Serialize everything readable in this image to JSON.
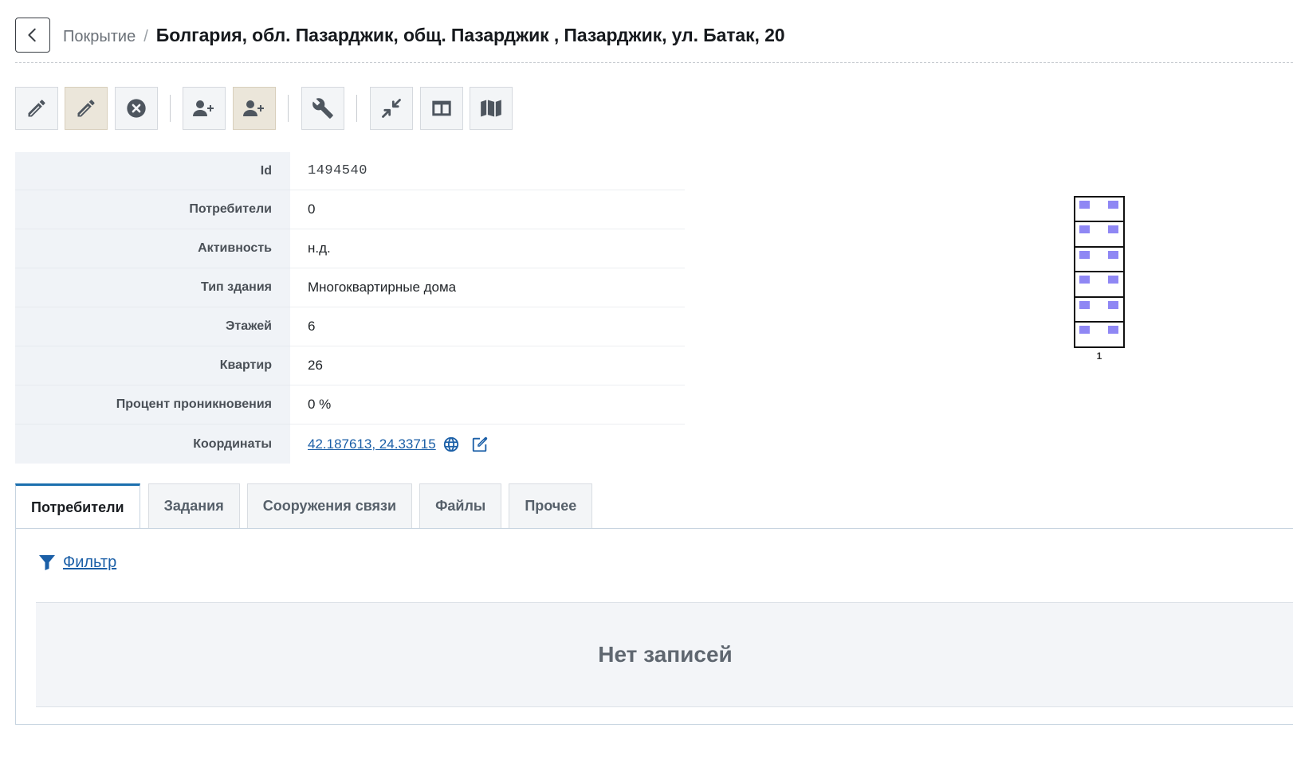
{
  "breadcrumb": {
    "parent": "Покрытие",
    "separator": "/",
    "title": "Болгария, обл. Пазарджик, общ. Пазарджик , Пазарджик, ул. Батак, 20"
  },
  "toolbar": {
    "buttons": [
      {
        "icon": "pencil-icon"
      },
      {
        "icon": "pencil-icon",
        "active": true
      },
      {
        "icon": "close-circle-icon"
      },
      {
        "icon": "user-plus-icon"
      },
      {
        "icon": "user-plus-icon",
        "active": true
      },
      {
        "icon": "wrench-icon"
      },
      {
        "icon": "compress-icon"
      },
      {
        "icon": "columns-icon"
      },
      {
        "icon": "map-icon"
      }
    ]
  },
  "props": {
    "id": {
      "label": "Id",
      "value": "1494540"
    },
    "consumers": {
      "label": "Потребители",
      "value": "0"
    },
    "activity": {
      "label": "Активность",
      "value": "н.д."
    },
    "building_type": {
      "label": "Тип здания",
      "value": "Многоквартирные дома"
    },
    "floors": {
      "label": "Этажей",
      "value": "6"
    },
    "apartments": {
      "label": "Квартир",
      "value": "26"
    },
    "penetration": {
      "label": "Процент проникновения",
      "value": "0 %"
    },
    "coordinates": {
      "label": "Координаты",
      "value": "42.187613, 24.33715"
    }
  },
  "building": {
    "floors": 6,
    "entrance_label": "1",
    "window_color": "#8f87f4"
  },
  "tabs": [
    {
      "label": "Потребители",
      "active": true
    },
    {
      "label": "Задания"
    },
    {
      "label": "Сооружения связи"
    },
    {
      "label": "Файлы"
    },
    {
      "label": "Прочее"
    }
  ],
  "panel": {
    "filter_label": "Фильтр",
    "empty_text": "Нет записей"
  },
  "colors": {
    "link": "#1b5fa7",
    "active_tab_border": "#1b6fae",
    "active_button_bg": "#ebe6da"
  }
}
